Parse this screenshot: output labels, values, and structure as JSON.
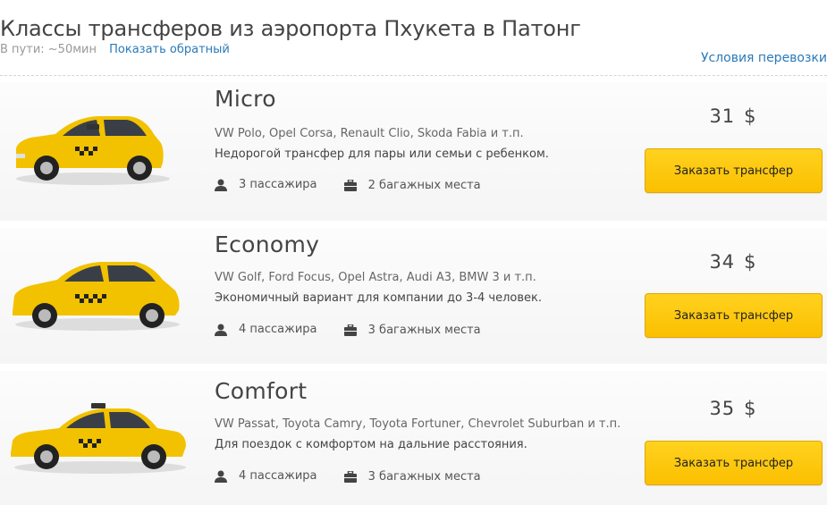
{
  "header": {
    "title": "Классы трансферов из аэропорта Пхукета в Патонг",
    "duration": "В пути: ~50мин",
    "reverse_link": "Показать обратный",
    "terms_link": "Условия перевозки"
  },
  "colors": {
    "link": "#2a7ab8",
    "button": "#fbbf00",
    "taxi_body": "#f2c200"
  },
  "classes": [
    {
      "name": "Micro",
      "examples": "VW Polo, Opel Corsa, Renault Clio, Skoda Fabia и т.п.",
      "description": "Недорогой трансфер для пары или семьи с ребенком.",
      "passengers": "3 пассажира",
      "luggage": "2 багажных места",
      "price": "31",
      "currency": "$",
      "button": "Заказать трансфер",
      "image": "hatchback-taxi"
    },
    {
      "name": "Economy",
      "examples": "VW Golf, Ford Focus, Opel Astra, Audi A3, BMW 3 и т.п.",
      "description": "Экономичный вариант для компании до 3-4 человек.",
      "passengers": "4 пассажира",
      "luggage": "3 багажных места",
      "price": "34",
      "currency": "$",
      "button": "Заказать трансфер",
      "image": "compact-taxi"
    },
    {
      "name": "Comfort",
      "examples": "VW Passat, Toyota Camry, Toyota Fortuner, Chevrolet Suburban и т.п.",
      "description": "Для поездок с комфортом на дальние расстояния.",
      "passengers": "4 пассажира",
      "luggage": "3 багажных места",
      "price": "35",
      "currency": "$",
      "button": "Заказать трансфер",
      "image": "sedan-taxi"
    }
  ]
}
